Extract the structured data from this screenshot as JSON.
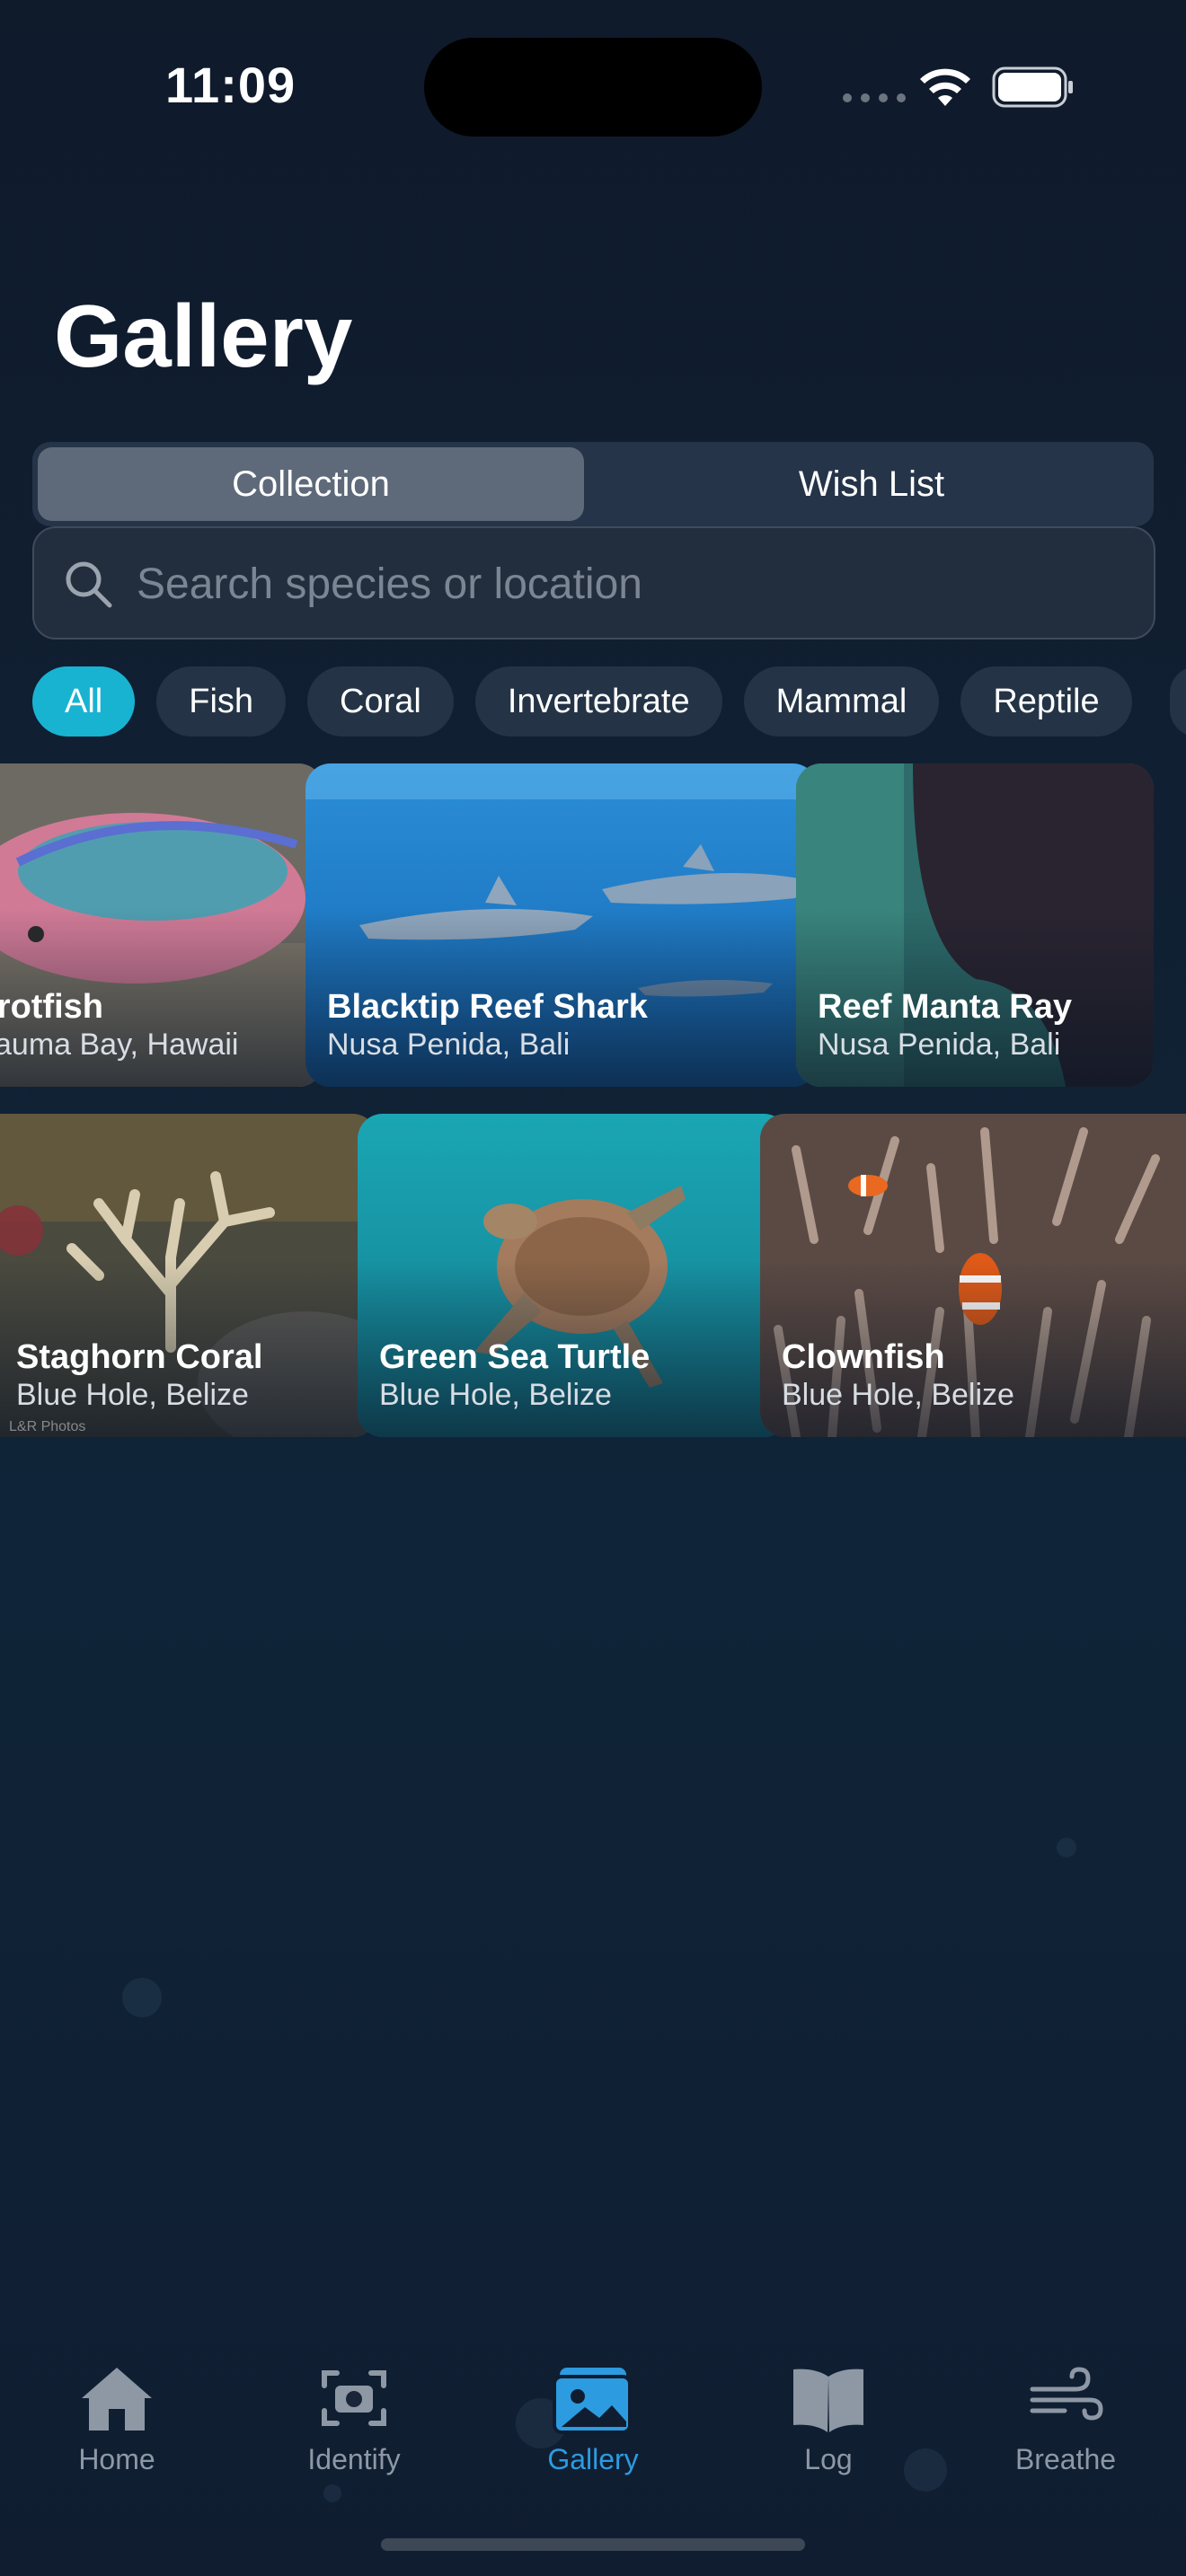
{
  "status_bar": {
    "time": "11:09"
  },
  "header": {
    "title": "Gallery"
  },
  "segmented": {
    "options": [
      "Collection",
      "Wish List"
    ],
    "selected": "Collection"
  },
  "search": {
    "placeholder": "Search species or location",
    "value": ""
  },
  "filters": {
    "chips": [
      "All",
      "Fish",
      "Coral",
      "Invertebrate",
      "Mammal",
      "Reptile"
    ],
    "selected": "All"
  },
  "gallery": {
    "row1": [
      {
        "name": "rrotfish",
        "location": "auma Bay, Hawaii"
      },
      {
        "name": "Blacktip Reef Shark",
        "location": "Nusa Penida, Bali"
      },
      {
        "name": "Reef Manta Ray",
        "location": "Nusa Penida, Bali"
      }
    ],
    "row2": [
      {
        "name": "Staghorn Coral",
        "location": "Blue Hole, Belize",
        "credit": "L&R Photos"
      },
      {
        "name": "Green Sea Turtle",
        "location": "Blue Hole, Belize"
      },
      {
        "name": "Clownfish",
        "location": "Blue Hole, Belize"
      }
    ]
  },
  "tabbar": {
    "items": [
      {
        "label": "Home",
        "icon": "home-icon"
      },
      {
        "label": "Identify",
        "icon": "camera-icon"
      },
      {
        "label": "Gallery",
        "icon": "photos-icon"
      },
      {
        "label": "Log",
        "icon": "book-icon"
      },
      {
        "label": "Breathe",
        "icon": "wind-icon"
      }
    ],
    "selected": "Gallery",
    "accent": "#2c9be0"
  },
  "colors": {
    "chip_active": "#19b3d2",
    "background": "#0f1a2b"
  }
}
